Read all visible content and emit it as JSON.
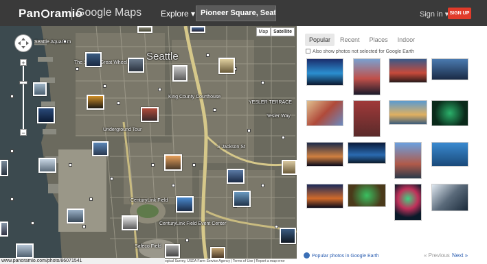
{
  "header": {
    "brand": "Panoramio",
    "brand_sub": "Google Maps",
    "explore_label": "Explore ▾",
    "search_value": "Pioneer Square, Seattle, WA, U",
    "signin_label": "Sign in ▾",
    "signup_label": "SIGN UP"
  },
  "map": {
    "type_buttons": [
      "Map",
      "Satellite"
    ],
    "active_type": "Satellite",
    "labels": {
      "aquarium": "Seattle Aquarium",
      "city": "Seattle",
      "great_wheel": "The Seattle Great Wheel",
      "courthouse": "King County Courthouse",
      "yesler_terrace": "YESLER TERRACE",
      "yesler_way": "Yesler Way",
      "jackson": "S Jackson St",
      "underground": "Underground Tour",
      "centurylink": "CenturyLink Field",
      "safeco": "Safeco Field",
      "centurylink_events": "CenturyLink Field Event Center"
    },
    "zoom_in": "+",
    "zoom_out": "−",
    "status_url": "www.panoramio.com/photo/86071541",
    "attribution": "ogical Survey, USDA Farm Service Agency | Terms of Use | Report a map error"
  },
  "panel": {
    "tabs": [
      "Popular",
      "Recent",
      "Places",
      "Indoor"
    ],
    "active_tab": "Popular",
    "checkbox_label": "Also show photos not selected for Google Earth",
    "photos": [
      {
        "name": "photo-night-skyline"
      },
      {
        "name": "photo-downtown-reflection"
      },
      {
        "name": "photo-great-wheel-dusk"
      },
      {
        "name": "photo-skyline-evening"
      },
      {
        "name": "photo-murals"
      },
      {
        "name": "photo-red-building"
      },
      {
        "name": "photo-waterfront-panorama"
      },
      {
        "name": "photo-wheel-green"
      },
      {
        "name": "photo-city-night"
      },
      {
        "name": "photo-harbor-night"
      },
      {
        "name": "photo-towers-day"
      },
      {
        "name": "photo-skyline-blue"
      },
      {
        "name": "photo-wheel-night"
      },
      {
        "name": "photo-wheel-green-lights"
      },
      {
        "name": "photo-wheel-vertical"
      },
      {
        "name": "photo-glass-facade"
      }
    ],
    "google_earth_link": "Popular photos in Google Earth",
    "prev_label": "« Previous",
    "next_label": "Next »"
  },
  "colors": {
    "header_bg": "#3a3a3a",
    "signup_bg": "#e13b2a",
    "link": "#2a5db0"
  }
}
